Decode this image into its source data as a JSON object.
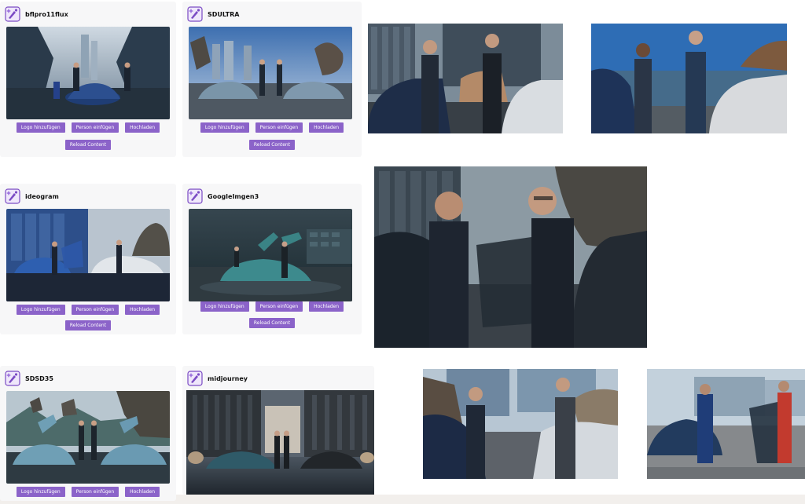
{
  "cards": [
    {
      "title": "bflpro11flux",
      "buttons": {
        "logo": "Logo hinzufügen",
        "person": "Person einfügen",
        "upload": "Hochladen",
        "reload": "Reload Content"
      }
    },
    {
      "title": "SDULTRA",
      "buttons": {
        "logo": "Logo hinzufügen",
        "person": "Person einfügen",
        "upload": "Hochladen",
        "reload": "Reload Content"
      }
    },
    {
      "title": "ideogram",
      "buttons": {
        "logo": "Logo hinzufügen",
        "person": "Person einfügen",
        "upload": "Hochladen",
        "reload": "Reload Content"
      }
    },
    {
      "title": "GoogleImgen3",
      "buttons": {
        "logo": "Logo hinzufügen",
        "person": "Person einfügen",
        "upload": "Hochladen",
        "reload": "Reload Content"
      }
    },
    {
      "title": "SDSD35",
      "buttons": {
        "logo": "Logo hinzufügen",
        "person": "Person einfügen",
        "upload": "Hochladen"
      }
    },
    {
      "title": "midjourney"
    }
  ],
  "colors": {
    "button": "#8b63c9",
    "card_bg": "#f7f7f8",
    "logo": "#7b4bc4"
  },
  "icons": {
    "card_logo": "sparkle-brush-logo-icon"
  }
}
